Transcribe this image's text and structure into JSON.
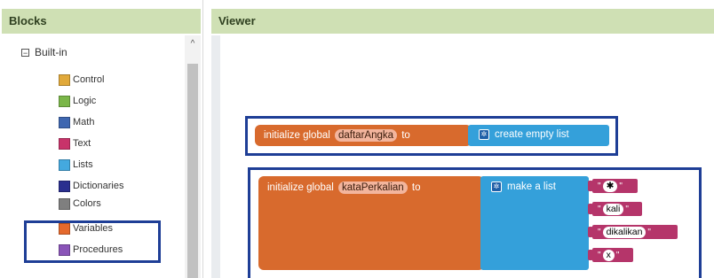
{
  "blocks_panel": {
    "title": "Blocks",
    "tree": {
      "root_label": "Built-in",
      "collapse_glyph": "⊟",
      "items": [
        {
          "label": "Control",
          "color": "#e1a93a"
        },
        {
          "label": "Logic",
          "color": "#7ab648"
        },
        {
          "label": "Math",
          "color": "#3f67b0"
        },
        {
          "label": "Text",
          "color": "#c8336a"
        },
        {
          "label": "Lists",
          "color": "#44a9df"
        },
        {
          "label": "Dictionaries",
          "color": "#2a2f8f"
        },
        {
          "label": "Colors",
          "color": "#7f7f7f"
        },
        {
          "label": "Variables",
          "color": "#e5692d"
        },
        {
          "label": "Procedures",
          "color": "#8a54b8"
        }
      ]
    },
    "scroll_up_glyph": "^"
  },
  "viewer": {
    "title": "Viewer",
    "block1": {
      "prefix": "initialize global",
      "var_name": "daftarAngka",
      "to_label": "to",
      "value_label": "create empty list"
    },
    "block2": {
      "prefix": "initialize global",
      "var_name": "kataPerkalian",
      "to_label": "to",
      "value_label": "make a list",
      "items": [
        "✱",
        "kali",
        "dikalikan",
        "x"
      ]
    },
    "quote_glyph": "\"",
    "gear_glyph": "✲"
  },
  "colors": {
    "header_bg": "#cfe0b4",
    "highlight_border": "#1e3e96",
    "variable_block": "#d86a2d",
    "list_block": "#34a0da",
    "text_block": "#b5356a"
  }
}
